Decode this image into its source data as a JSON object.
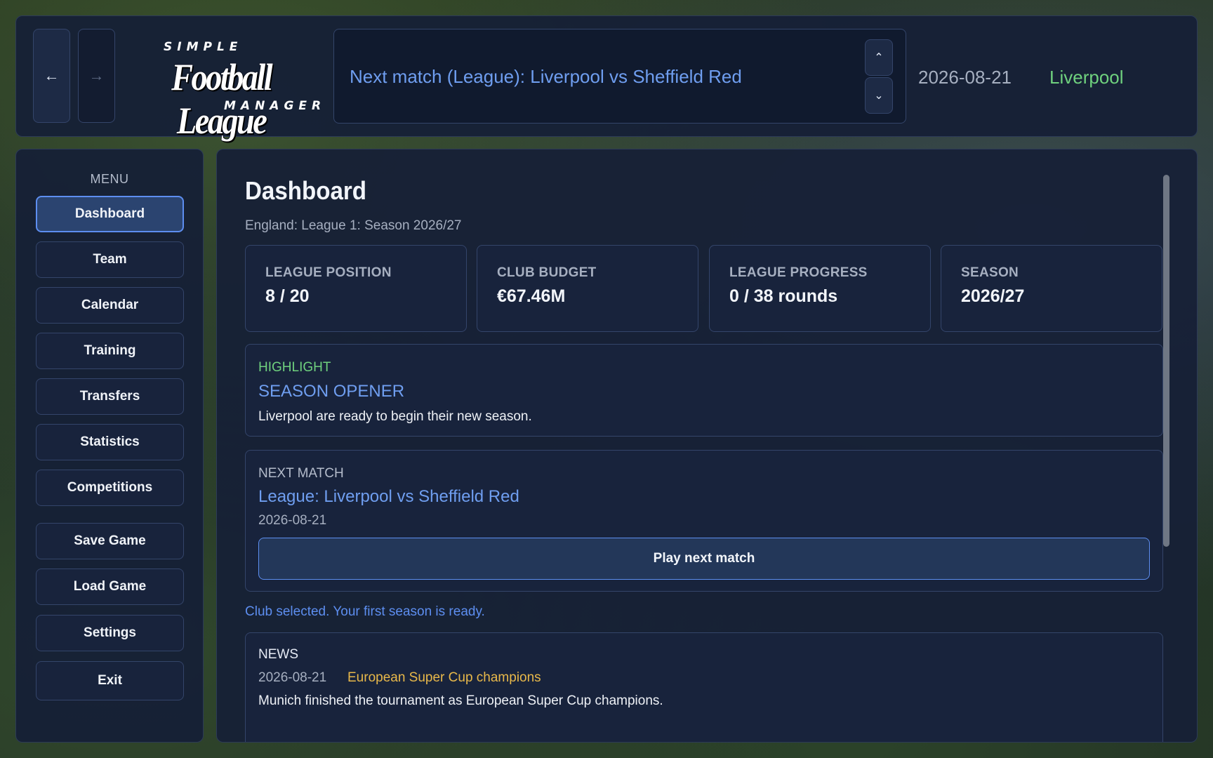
{
  "topbar": {
    "back_icon": "←",
    "forward_icon": "→",
    "logo": {
      "line1": "SIMPLE",
      "line2": "Football League",
      "line3": "MANAGER"
    },
    "ticker_text": "Next match (League): Liverpool vs Sheffield Red",
    "up_icon": "⌃",
    "down_icon": "⌄",
    "date": "2026-08-21",
    "club": "Liverpool"
  },
  "sidebar": {
    "menu_label": "MENU",
    "items": [
      {
        "label": "Dashboard",
        "active": true
      },
      {
        "label": "Team"
      },
      {
        "label": "Calendar"
      },
      {
        "label": "Training"
      },
      {
        "label": "Transfers"
      },
      {
        "label": "Statistics"
      },
      {
        "label": "Competitions"
      },
      {
        "label": "Save Game"
      },
      {
        "label": "Load Game"
      },
      {
        "label": "Settings"
      },
      {
        "label": "Exit"
      }
    ]
  },
  "main": {
    "title": "Dashboard",
    "subtitle": "England: League 1: Season 2026/27",
    "stats": [
      {
        "label": "LEAGUE POSITION",
        "value": "8 / 20"
      },
      {
        "label": "CLUB BUDGET",
        "value": "€67.46M"
      },
      {
        "label": "LEAGUE PROGRESS",
        "value": "0 / 38 rounds"
      },
      {
        "label": "SEASON",
        "value": "2026/27"
      }
    ],
    "highlight": {
      "tag": "HIGHLIGHT",
      "heading": "SEASON OPENER",
      "body": "Liverpool are ready to begin their new season."
    },
    "next_match": {
      "tag": "NEXT MATCH",
      "heading": "League: Liverpool vs Sheffield Red",
      "date": "2026-08-21",
      "button": "Play next match"
    },
    "status_message": "Club selected. Your first season is ready.",
    "news": {
      "tag": "NEWS",
      "date": "2026-08-21",
      "heading": "European Super Cup champions",
      "body": "Munich finished the tournament as European Super Cup champions."
    }
  },
  "colors": {
    "accent_blue": "#6f9ef0",
    "club_green": "#6fd17e",
    "news_gold": "#e8b84a"
  }
}
